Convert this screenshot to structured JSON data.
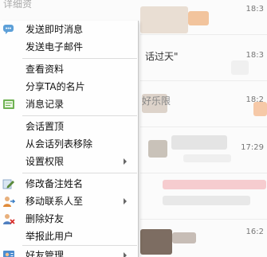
{
  "background": {
    "header_fragment": "详细资",
    "row1_text": "话过天\"",
    "row2_text": "好乐限",
    "times": [
      "18:3",
      "18:3",
      "18:2",
      "17:29",
      "16:2"
    ]
  },
  "menu": {
    "items": [
      {
        "label": "发送即时消息",
        "icon": "chat-bubble-icon",
        "submenu": false
      },
      {
        "label": "发送电子邮件",
        "icon": "",
        "submenu": false
      },
      {
        "label": "查看资料",
        "icon": "",
        "submenu": false
      },
      {
        "label": "分享TA的名片",
        "icon": "",
        "submenu": false
      },
      {
        "label": "消息记录",
        "icon": "message-log-icon",
        "submenu": false
      },
      {
        "label": "会话置顶",
        "icon": "",
        "submenu": false
      },
      {
        "label": "从会话列表移除",
        "icon": "",
        "submenu": false
      },
      {
        "label": "设置权限",
        "icon": "",
        "submenu": true
      },
      {
        "label": "修改备注姓名",
        "icon": "edit-pencil-icon",
        "submenu": false
      },
      {
        "label": "移动联系人至",
        "icon": "move-contact-icon",
        "submenu": true
      },
      {
        "label": "删除好友",
        "icon": "delete-contact-icon",
        "submenu": false
      },
      {
        "label": "举报此用户",
        "icon": "",
        "submenu": false
      },
      {
        "label": "好友管理",
        "icon": "contact-card-icon",
        "submenu": true
      }
    ]
  },
  "colors": {
    "menu_bg": "#fefefe",
    "separator": "#dcdcdc",
    "text": "#111111"
  }
}
